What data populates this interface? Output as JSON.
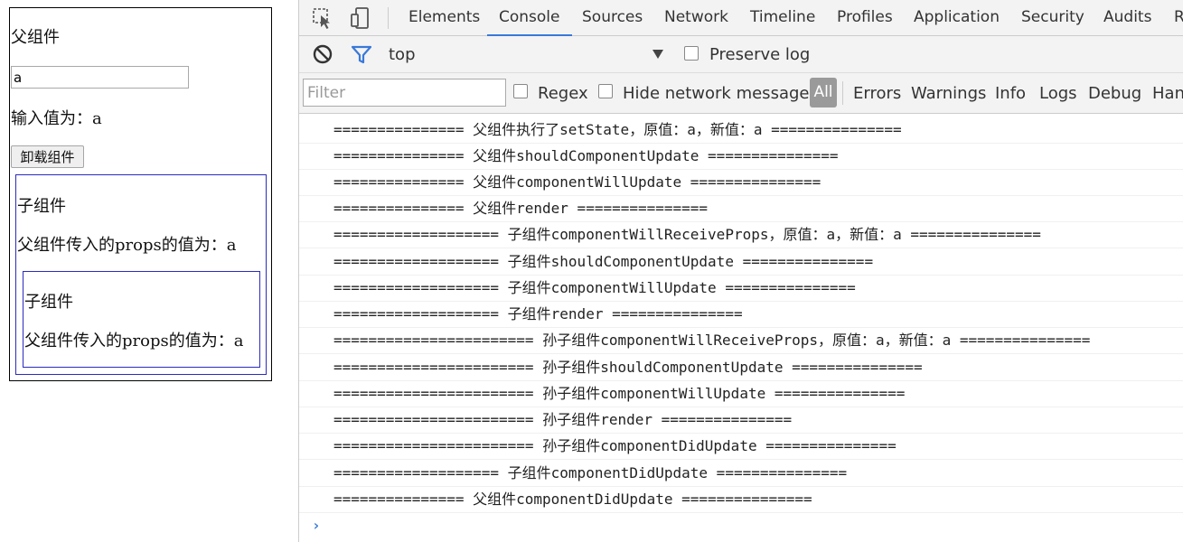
{
  "page": {
    "parent_title": "父组件",
    "input_value": "a",
    "parent_value_text": "输入值为：a",
    "unmount_button": "卸载组件",
    "child": {
      "title": "子组件",
      "props_text": "父组件传入的props的值为：a"
    },
    "grandchild": {
      "title": "子组件",
      "props_text": "父组件传入的props的值为：a"
    }
  },
  "devtools": {
    "tabs": [
      {
        "label": "Elements"
      },
      {
        "label": "Console"
      },
      {
        "label": "Sources"
      },
      {
        "label": "Network"
      },
      {
        "label": "Timeline"
      },
      {
        "label": "Profiles"
      },
      {
        "label": "Application"
      },
      {
        "label": "Security"
      },
      {
        "label": "Audits"
      },
      {
        "label": "R"
      }
    ],
    "active_tab": "Console",
    "context": "top",
    "preserve_log": "Preserve log",
    "filter_placeholder": "Filter",
    "regex_label": "Regex",
    "hide_network_label": "Hide network messages",
    "levels": {
      "all": "All",
      "errors": "Errors",
      "warnings": "Warnings",
      "info": "Info",
      "logs": "Logs",
      "debug": "Debug",
      "handled": "Han"
    },
    "accent_color": "#3879d9",
    "logs": [
      "=============== 父组件执行了setState，原值：a，新值：a ===============",
      "=============== 父组件shouldComponentUpdate ===============",
      "=============== 父组件componentWillUpdate ===============",
      "=============== 父组件render ===============",
      "=================== 子组件componentWillReceiveProps，原值：a，新值：a ===============",
      "=================== 子组件shouldComponentUpdate ===============",
      "=================== 子组件componentWillUpdate ===============",
      "=================== 子组件render ===============",
      "======================= 孙子组件componentWillReceiveProps，原值：a，新值：a ===============",
      "======================= 孙子组件shouldComponentUpdate ===============",
      "======================= 孙子组件componentWillUpdate ===============",
      "======================= 孙子组件render ===============",
      "======================= 孙子组件componentDidUpdate ===============",
      "=================== 子组件componentDidUpdate ===============",
      "=============== 父组件componentDidUpdate ==============="
    ],
    "prompt_symbol": "›"
  }
}
